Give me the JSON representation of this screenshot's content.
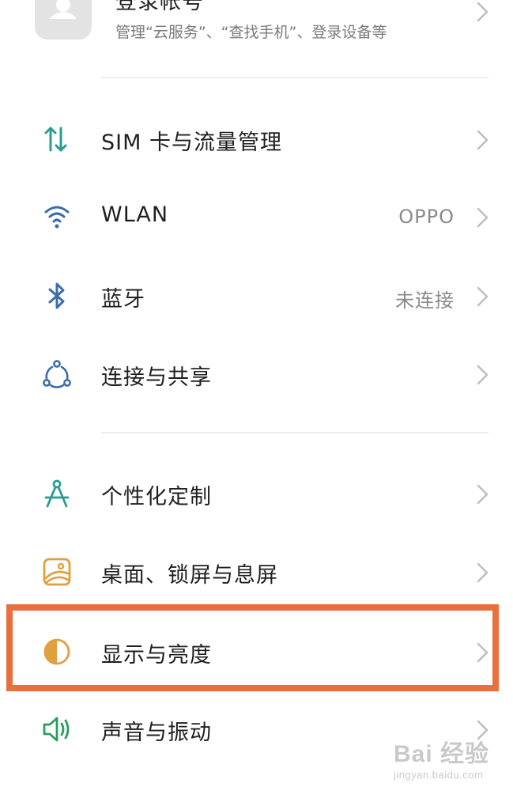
{
  "account": {
    "title": "登录帐号",
    "subtitle": "管理“云服务”、“查找手机”、登录设备等"
  },
  "rows": [
    {
      "id": "sim",
      "label": "SIM 卡与流量管理",
      "value": "",
      "icon": "data-transfer-icon",
      "icon_color": "#2a9d8f"
    },
    {
      "id": "wlan",
      "label": "WLAN",
      "value": "OPPO",
      "icon": "wifi-icon",
      "icon_color": "#3b6ea8"
    },
    {
      "id": "bluetooth",
      "label": "蓝牙",
      "value": "未连接",
      "icon": "bluetooth-icon",
      "icon_color": "#3b6ea8"
    },
    {
      "id": "connection",
      "label": "连接与共享",
      "value": "",
      "icon": "share-network-icon",
      "icon_color": "#3b6ea8"
    },
    {
      "id": "personalize",
      "label": "个性化定制",
      "value": "",
      "icon": "compass-icon",
      "icon_color": "#2a9d8f"
    },
    {
      "id": "desktop",
      "label": "桌面、锁屏与息屏",
      "value": "",
      "icon": "wallpaper-icon",
      "icon_color": "#e0a040"
    },
    {
      "id": "display",
      "label": "显示与亮度",
      "value": "",
      "icon": "brightness-icon",
      "icon_color": "#e0a040"
    },
    {
      "id": "sound",
      "label": "声音与振动",
      "value": "",
      "icon": "speaker-icon",
      "icon_color": "#2a9d5f"
    }
  ],
  "highlight_color": "#e8703c",
  "watermark": {
    "brand": "Bai 经验",
    "url": "jingyan.baidu.com"
  }
}
